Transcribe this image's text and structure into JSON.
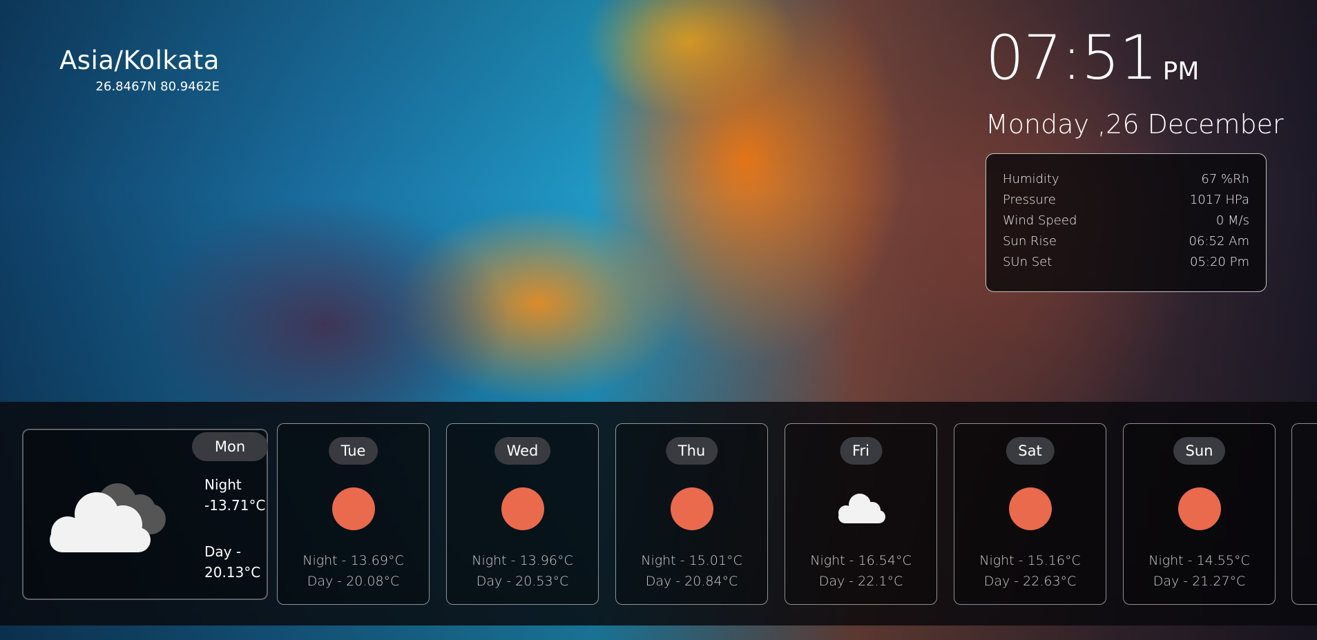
{
  "location": {
    "timezone": "Asia/Kolkata",
    "coords": "26.8467N 80.9462E"
  },
  "clock": {
    "time": "07:51",
    "ampm": "PM",
    "date": "Monday ,26 December"
  },
  "details": [
    {
      "label": "Humidity",
      "value": "67 %Rh"
    },
    {
      "label": "Pressure",
      "value": "1017 HPa"
    },
    {
      "label": "Wind Speed",
      "value": "0 M/s"
    },
    {
      "label": "Sun Rise",
      "value": "06:52 Am"
    },
    {
      "label": "SUn Set",
      "value": "05:20 Pm"
    }
  ],
  "today": {
    "day": "Mon",
    "icon": "cloudy-icon",
    "night_label": "Night",
    "night_value": "-13.71°C",
    "day_label": "Day -",
    "day_value": "20.13°C"
  },
  "forecast": [
    {
      "day": "Tue",
      "icon": "sun-icon",
      "night": "Night - 13.69°C",
      "dayt": "Day - 20.08°C"
    },
    {
      "day": "Wed",
      "icon": "sun-icon",
      "night": "Night - 13.96°C",
      "dayt": "Day - 20.53°C"
    },
    {
      "day": "Thu",
      "icon": "sun-icon",
      "night": "Night - 15.01°C",
      "dayt": "Day - 20.84°C"
    },
    {
      "day": "Fri",
      "icon": "cloud-icon",
      "night": "Night - 16.54°C",
      "dayt": "Day - 22.1°C"
    },
    {
      "day": "Sat",
      "icon": "sun-icon",
      "night": "Night - 15.16°C",
      "dayt": "Day - 22.63°C"
    },
    {
      "day": "Sun",
      "icon": "sun-icon",
      "night": "Night - 14.55°C",
      "dayt": "Day - 21.27°C"
    }
  ],
  "colors": {
    "sun": "#ea6a4d",
    "pill": "#3a3b40"
  }
}
